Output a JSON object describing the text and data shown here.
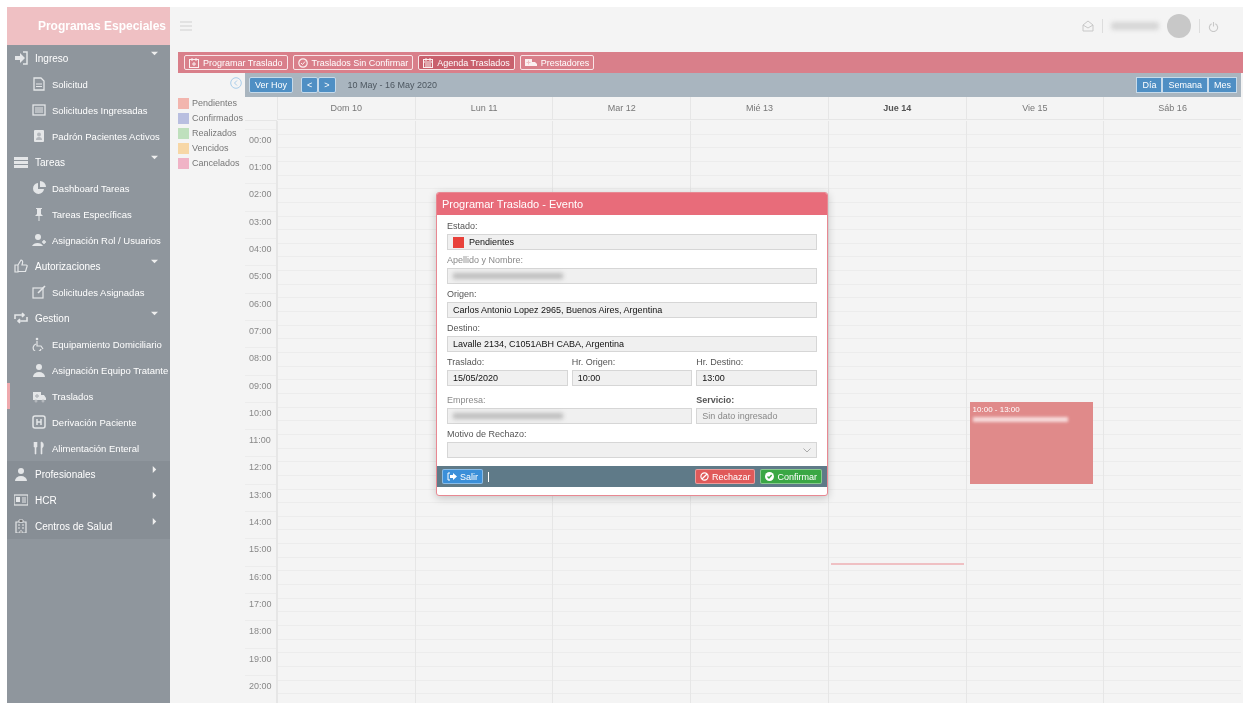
{
  "sidebar": {
    "brand": "Programas Especiales",
    "items": [
      {
        "label": "Ingreso",
        "expanded": true,
        "children": [
          {
            "label": "Solicitud",
            "selected": false
          },
          {
            "label": "Solicitudes Ingresadas",
            "selected": false
          },
          {
            "label": "Padrón Pacientes Activos",
            "selected": false
          }
        ]
      },
      {
        "label": "Tareas",
        "expanded": true,
        "children": [
          {
            "label": "Dashboard Tareas",
            "selected": false
          },
          {
            "label": "Tareas Específicas",
            "selected": false
          },
          {
            "label": "Asignación Rol / Usuarios",
            "selected": false
          }
        ]
      },
      {
        "label": "Autorizaciones",
        "expanded": true,
        "children": [
          {
            "label": "Solicitudes Asignadas",
            "selected": false
          }
        ]
      },
      {
        "label": "Gestion",
        "expanded": true,
        "children": [
          {
            "label": "Equipamiento Domiciliario",
            "selected": false
          },
          {
            "label": "Asignación Equipo Tratante",
            "selected": false
          },
          {
            "label": "Traslados",
            "selected": true
          },
          {
            "label": "Derivación Paciente",
            "selected": false
          },
          {
            "label": "Alimentación Enteral",
            "selected": false
          }
        ]
      },
      {
        "label": "Profesionales",
        "expanded": false
      },
      {
        "label": "HCR",
        "expanded": false
      },
      {
        "label": "Centros de Salud",
        "expanded": false
      }
    ]
  },
  "toolbar": [
    {
      "label": "Programar Traslado",
      "selected": false
    },
    {
      "label": "Traslados Sin Confirmar",
      "selected": false
    },
    {
      "label": "Agenda Traslados",
      "selected": true
    },
    {
      "label": "Prestadores",
      "selected": false
    }
  ],
  "legend": [
    {
      "label": "Pendientes",
      "color": "#f2b5ae"
    },
    {
      "label": "Confirmados",
      "color": "#b9bfe0"
    },
    {
      "label": "Realizados",
      "color": "#bfe0bd"
    },
    {
      "label": "Vencidos",
      "color": "#f7d7a6"
    },
    {
      "label": "Cancelados",
      "color": "#f0b3c6"
    }
  ],
  "calendar": {
    "today_button": "Ver Hoy",
    "prev": "<",
    "next": ">",
    "range": "10 May - 16 May 2020",
    "views": [
      {
        "label": "Día",
        "selected": false
      },
      {
        "label": "Semana",
        "selected": false
      },
      {
        "label": "Mes",
        "selected": false
      }
    ],
    "days": [
      {
        "label": "Dom 10",
        "today": false
      },
      {
        "label": "Lun 11",
        "today": false
      },
      {
        "label": "Mar 12",
        "today": false
      },
      {
        "label": "Mié 13",
        "today": false
      },
      {
        "label": "Jue 14",
        "today": true
      },
      {
        "label": "Vie 15",
        "today": false,
        "events": [
          {
            "time": "10:00 - 13:00",
            "blurred_title": true
          }
        ]
      },
      {
        "label": "Sáb 16",
        "today": false
      }
    ],
    "hours": [
      "00:00",
      "01:00",
      "02:00",
      "03:00",
      "04:00",
      "05:00",
      "06:00",
      "07:00",
      "08:00",
      "09:00",
      "10:00",
      "11:00",
      "12:00",
      "13:00",
      "14:00",
      "15:00",
      "16:00",
      "17:00",
      "18:00",
      "19:00",
      "20:00"
    ]
  },
  "modal": {
    "title": "Programar Traslado - Evento",
    "fields": [
      {
        "kind": "status",
        "label": "Estado:",
        "value": "Pendientes",
        "color": "#e8413a",
        "disabled": false,
        "bold_label": false
      },
      {
        "kind": "blurred",
        "label": "Apellido y Nombre:",
        "disabled": true,
        "bold_label": false
      },
      {
        "kind": "text",
        "label": "Origen:",
        "value": "Carlos Antonio Lopez 2965, Buenos Aires, Argentina",
        "disabled": false,
        "bold_label": false
      },
      {
        "kind": "text",
        "label": "Destino:",
        "value": "Lavalle 2134, C1051ABH CABA, Argentina",
        "disabled": false,
        "bold_label": false
      },
      {
        "kind": "text",
        "label": "Traslado:",
        "value": "15/05/2020",
        "disabled": false,
        "bold_label": false
      },
      {
        "kind": "text",
        "label": "Hr. Origen:",
        "value": "10:00",
        "disabled": false,
        "bold_label": false
      },
      {
        "kind": "text",
        "label": "Hr. Destino:",
        "value": "13:00",
        "disabled": false,
        "bold_label": false
      },
      {
        "kind": "blurred",
        "label": "Empresa:",
        "disabled": true,
        "bold_label": false
      },
      {
        "kind": "placeholder",
        "label": "Servicio:",
        "placeholder": "Sin dato ingresado",
        "disabled": false,
        "bold_label": true
      },
      {
        "kind": "select",
        "label": "Motivo de Rechazo:",
        "disabled": false,
        "bold_label": false
      }
    ],
    "buttons": [
      {
        "kind": "exit",
        "label": "Salir"
      },
      {
        "kind": "reject",
        "label": "Rechazar"
      },
      {
        "kind": "confirm",
        "label": "Confirmar"
      }
    ]
  }
}
